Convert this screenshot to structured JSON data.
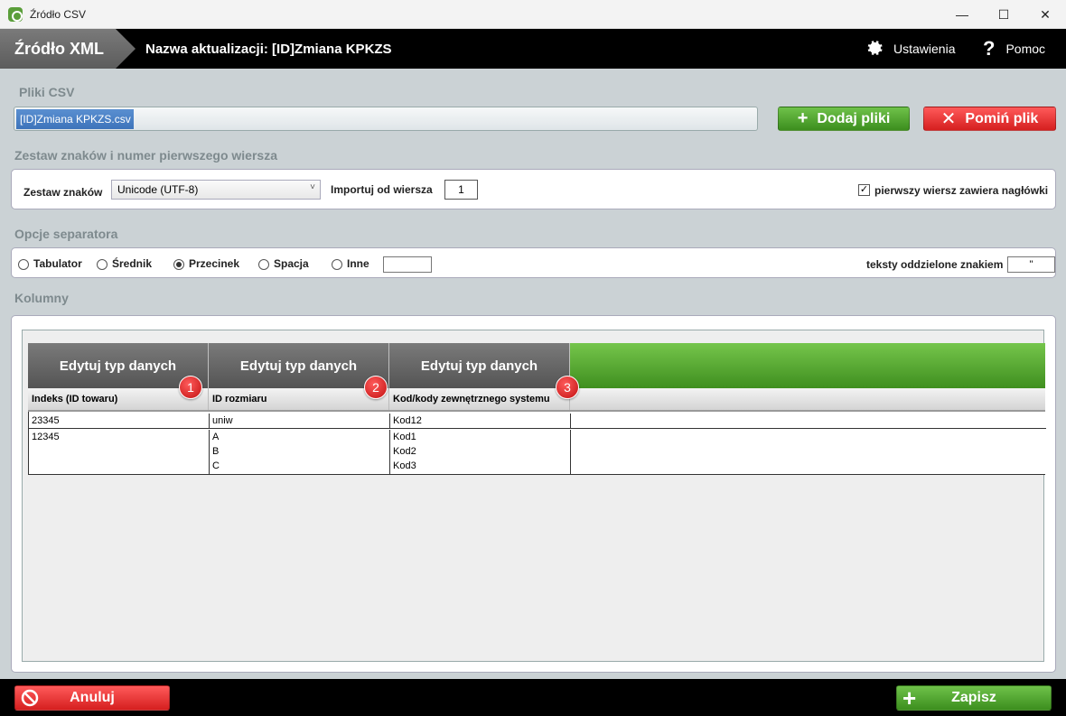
{
  "window": {
    "title": "Źródło CSV",
    "minimize": "—",
    "maximize": "☐",
    "close": "✕"
  },
  "header": {
    "tab": "Źródło XML",
    "title": "Nazwa aktualizacji: [ID]Zmiana KPKZS",
    "settings": "Ustawienia",
    "help": "Pomoc"
  },
  "files": {
    "section": "Pliki CSV",
    "selected_file": "[ID]Zmiana KPKZS.csv",
    "add_button": "Dodaj pliki",
    "skip_button": "Pomiń plik"
  },
  "charset": {
    "section": "Zestaw znaków i numer pierwszego wiersza",
    "charset_label": "Zestaw znaków",
    "charset_value": "Unicode (UTF-8)",
    "import_label": "Importuj od wiersza",
    "import_value": "1",
    "header_checkbox_label": "pierwszy wiersz zawiera nagłówki",
    "header_checked": true
  },
  "separator": {
    "section": "Opcje separatora",
    "options": [
      "Tabulator",
      "Średnik",
      "Przecinek",
      "Spacja",
      "Inne"
    ],
    "selected": "Przecinek",
    "other_value": "",
    "quote_label": "teksty oddzielone znakiem",
    "quote_value": "\""
  },
  "columns": {
    "section": "Kolumny",
    "edit_button": "Edytuj typ danych",
    "headers": [
      "Indeks (ID towaru)",
      "ID rozmiaru",
      "Kod/kody zewnętrznego systemu"
    ],
    "badges": [
      "1",
      "2",
      "3"
    ],
    "rows": [
      [
        "23345",
        "uniw",
        "Kod12"
      ],
      [
        "12345",
        "A\nB\nC",
        "Kod1\nKod2\nKod3"
      ]
    ]
  },
  "footer": {
    "cancel": "Anuluj",
    "save": "Zapisz"
  },
  "colors": {
    "green": "#4caf2a",
    "red": "#e62a2a",
    "header_bg": "#000000",
    "panel_bg": "#cbd2d5"
  }
}
